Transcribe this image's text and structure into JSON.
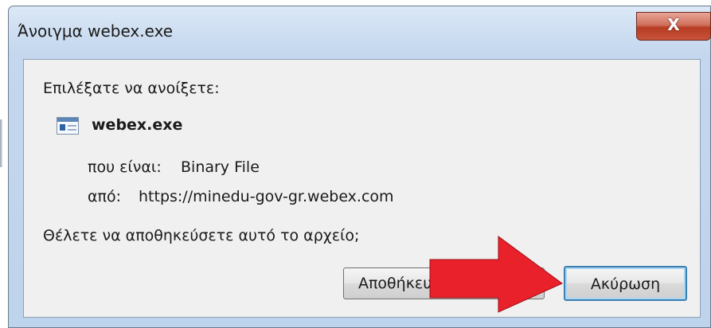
{
  "window": {
    "title": "Άνοιγμα webex.exe",
    "close_label": "X"
  },
  "dialog": {
    "prompt": "Επιλέξατε να ανοίξετε:",
    "file_name": "webex.exe",
    "type_label": "που είναι:",
    "type_value": "Binary File",
    "from_label": "από:",
    "from_value": "https://minedu-gov-gr.webex.com",
    "question": "Θέλετε να αποθηκεύσετε αυτό το αρχείο;"
  },
  "buttons": {
    "save_label": "Αποθήκευση",
    "cancel_label": "Ακύρωση"
  },
  "annotation": {
    "arrow_color": "#e8212b"
  }
}
